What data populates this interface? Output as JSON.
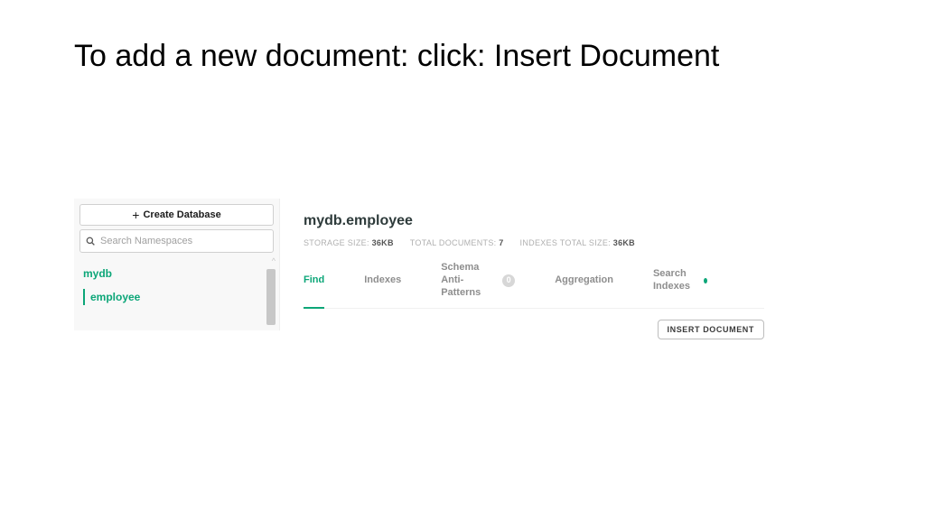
{
  "slide": {
    "title": "To add a new document: click: Insert Document"
  },
  "sidebar": {
    "create_db_label": "Create Database",
    "search_placeholder": "Search Namespaces",
    "db_name": "mydb",
    "collection_name": "employee"
  },
  "main": {
    "collection_title": "mydb.employee",
    "stats": {
      "storage_label": "STORAGE SIZE:",
      "storage_value": "36KB",
      "docs_label": "TOTAL DOCUMENTS:",
      "docs_value": "7",
      "indexes_label": "INDEXES TOTAL SIZE:",
      "indexes_value": "36KB"
    },
    "tabs": {
      "find": "Find",
      "indexes": "Indexes",
      "schema": "Schema Anti-Patterns",
      "schema_badge": "0",
      "aggregation": "Aggregation",
      "search": "Search Indexes"
    },
    "insert_button": "INSERT DOCUMENT"
  }
}
